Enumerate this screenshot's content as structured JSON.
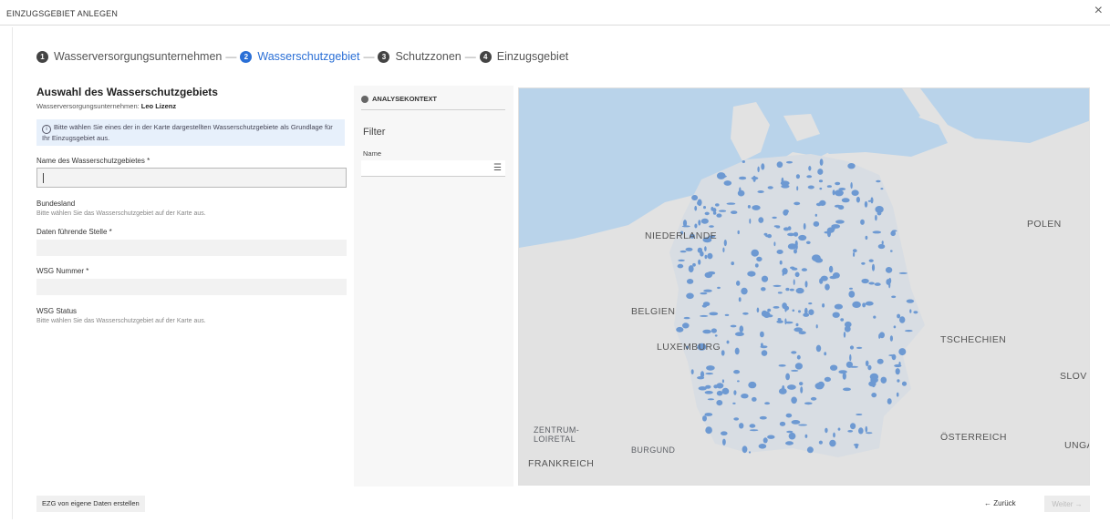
{
  "window": {
    "title": "EINZUGSGEBIET ANLEGEN",
    "close": "×"
  },
  "stepper": [
    {
      "num": "1",
      "label": "Wasserversorgungsunternehmen"
    },
    {
      "num": "2",
      "label": "Wasserschutzgebiet"
    },
    {
      "num": "3",
      "label": "Schutzzonen"
    },
    {
      "num": "4",
      "label": "Einzugsgebiet"
    }
  ],
  "stepper_separator": "—",
  "left": {
    "heading": "Auswahl des Wasserschutzgebiets",
    "company_label": "Wasserversorgungsunternehmen:",
    "company_value": "Leo Lizenz",
    "info_icon": "i",
    "info_text": "Bitte wählen Sie eines der in der Karte dargestellten Wasserschutzgebiete als Grundlage für Ihr Einzugsgebiet aus.",
    "name_label": "Name des Wasserschutzgebietes *",
    "name_value": "",
    "bundesland_label": "Bundesland",
    "bundesland_hint": "Bitte wählen Sie das Wasserschutzgebiet auf der Karte aus.",
    "datenstelle_label": "Daten führende Stelle *",
    "wsg_nummer_label": "WSG Nummer *",
    "wsg_status_label": "WSG Status",
    "wsg_status_hint": "Bitte wählen Sie das Wasserschutzgebiet auf der Karte aus."
  },
  "analysis": {
    "header": "ANALYSEKONTEXT",
    "filter_title": "Filter",
    "name_label": "Name",
    "list_icon": "☰"
  },
  "map": {
    "labels": {
      "niederlande": "NIEDERLANDE",
      "belgien": "BELGIEN",
      "luxemburg": "LUXEMBURG",
      "tschechien": "TSCHECHIEN",
      "oesterreich": "ÖSTERREICH",
      "polen": "POLEN",
      "slov": "SLOV",
      "unga": "UNGA",
      "frankreich": "FRANKREICH",
      "burgund": "BURGUND",
      "zentrum": "ZENTRUM-",
      "loire": "LOIRETAL"
    },
    "colors": {
      "sea": "#b9d3ea",
      "land": "#e2e2e2",
      "protected_area": "#5b8ed0"
    }
  },
  "footer": {
    "create_button": "EZG von eigene Daten erstellen",
    "back_button": "Zurück",
    "back_arrow": "←",
    "next_button": "Weiter →"
  }
}
